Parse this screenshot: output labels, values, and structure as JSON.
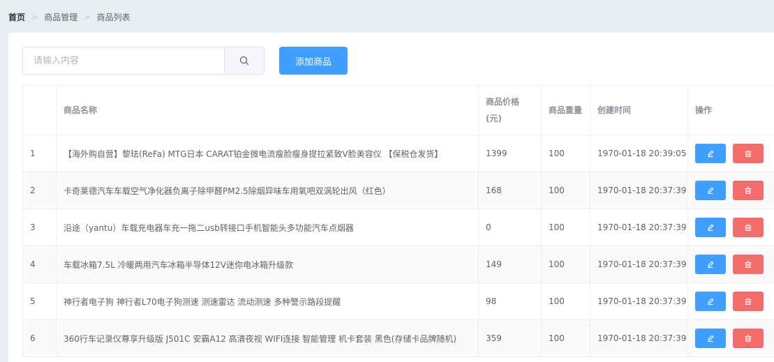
{
  "breadcrumb": [
    "首页",
    "商品管理",
    "商品列表"
  ],
  "search": {
    "placeholder": "请输入内容",
    "value": ""
  },
  "add_button_label": "添加商品",
  "table": {
    "headers": {
      "index": "",
      "name": "商品名称",
      "price": "商品价格(元)",
      "weight": "商品重量",
      "created": "创建时间",
      "actions": "操作"
    },
    "rows": [
      {
        "index": "1",
        "name": "【海外购自营】黎珐(ReFa) MTG日本 CARAT铂金微电流瘦脸瘦身提拉紧致V脸美容仪 【保税仓发货】",
        "price": "1399",
        "weight": "100",
        "created": "1970-01-18 20:39:05"
      },
      {
        "index": "2",
        "name": "卡奇莱德汽车车载空气净化器负离子除甲醛PM2.5除烟异味车用氧吧双涡轮出风（红色）",
        "price": "168",
        "weight": "100",
        "created": "1970-01-18 20:37:39"
      },
      {
        "index": "3",
        "name": "沿途（yantu）车载充电器车充一拖二usb转接口手机智能头多功能汽车点烟器",
        "price": "0",
        "weight": "100",
        "created": "1970-01-18 20:37:39"
      },
      {
        "index": "4",
        "name": "车载冰箱7.5L 冷暖两用汽车冰箱半导体12V迷你电冰箱升级款",
        "price": "149",
        "weight": "100",
        "created": "1970-01-18 20:37:39"
      },
      {
        "index": "5",
        "name": "神行者电子狗 神行者L70电子狗测速 测速雷达 流动测速 多种警示路段提醒",
        "price": "98",
        "weight": "100",
        "created": "1970-01-18 20:37:39"
      },
      {
        "index": "6",
        "name": "360行车记录仪尊享升级版 J501C 安霸A12 高清夜视 WIFI连接 智能管理 机卡套装 黑色(存储卡品牌随机)",
        "price": "359",
        "weight": "100",
        "created": "1970-01-18 20:37:39"
      }
    ]
  },
  "icons": {
    "search": "search-icon",
    "edit": "edit-icon",
    "delete": "trash-icon"
  },
  "colors": {
    "primary": "#409eff",
    "danger": "#f56c6c",
    "background": "#eaedf1"
  }
}
